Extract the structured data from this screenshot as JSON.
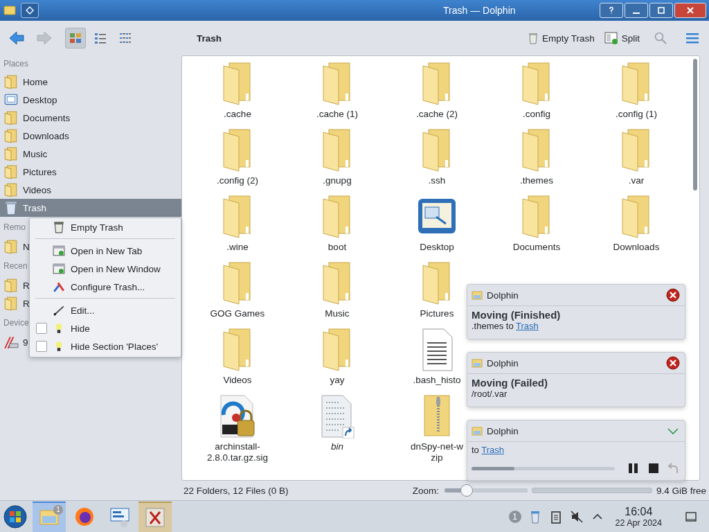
{
  "titlebar": {
    "title": "Trash — Dolphin"
  },
  "toolbar": {
    "view_modes": [
      {
        "selected": true
      },
      {
        "selected": false
      },
      {
        "selected": false
      }
    ],
    "location": "Trash",
    "actions": [
      {
        "label": "Empty Trash"
      },
      {
        "label": "Split"
      }
    ]
  },
  "sidebar": {
    "sections": [
      {
        "title": "Places",
        "items": [
          {
            "label": "Home",
            "selected": false
          },
          {
            "label": "Desktop",
            "selected": false
          },
          {
            "label": "Documents",
            "selected": false
          },
          {
            "label": "Downloads",
            "selected": false
          },
          {
            "label": "Music",
            "selected": false
          },
          {
            "label": "Pictures",
            "selected": false
          },
          {
            "label": "Videos",
            "selected": false
          },
          {
            "label": "Trash",
            "selected": true
          }
        ]
      },
      {
        "title": "Remo",
        "items": [
          {
            "label": "N",
            "selected": false
          }
        ]
      },
      {
        "title": "Recen",
        "items": [
          {
            "label": "R",
            "selected": false
          },
          {
            "label": "R",
            "selected": false
          }
        ]
      },
      {
        "title": "Device",
        "items": [
          {
            "label": "9",
            "selected": false
          }
        ]
      }
    ]
  },
  "context_menu": {
    "items": [
      {
        "kind": "action",
        "label": "Empty Trash"
      },
      {
        "kind": "separator"
      },
      {
        "kind": "action",
        "label": "Open in New Tab"
      },
      {
        "kind": "action",
        "label": "Open in New Window"
      },
      {
        "kind": "action",
        "label": "Configure Trash..."
      },
      {
        "kind": "separator"
      },
      {
        "kind": "action",
        "label": "Edit..."
      },
      {
        "kind": "check",
        "label": "Hide",
        "checked": false
      },
      {
        "kind": "check",
        "label": "Hide Section 'Places'",
        "checked": false
      }
    ]
  },
  "files": {
    "rows": [
      [
        {
          "kind": "folder",
          "name": ".cache"
        },
        {
          "kind": "folder",
          "name": ".cache (1)"
        },
        {
          "kind": "folder",
          "name": ".cache (2)"
        },
        {
          "kind": "folder",
          "name": ".config"
        },
        {
          "kind": "folder",
          "name": ".config (1)"
        }
      ],
      [
        {
          "kind": "folder",
          "name": ".config (2)"
        },
        {
          "kind": "folder",
          "name": ".gnupg"
        },
        {
          "kind": "folder",
          "name": ".ssh"
        },
        {
          "kind": "folder",
          "name": ".themes"
        },
        {
          "kind": "folder",
          "name": ".var"
        }
      ],
      [
        {
          "kind": "folder",
          "name": ".wine"
        },
        {
          "kind": "folder",
          "name": "boot"
        },
        {
          "kind": "desktop",
          "name": "Desktop"
        },
        {
          "kind": "folder",
          "name": "Documents"
        },
        {
          "kind": "folder",
          "name": "Downloads"
        }
      ],
      [
        {
          "kind": "folder",
          "name": "GOG Games"
        },
        {
          "kind": "folder",
          "name": "Music"
        },
        {
          "kind": "folder",
          "name": "Pictures"
        }
      ],
      [
        {
          "kind": "folder",
          "name": "Videos"
        },
        {
          "kind": "folder",
          "name": "yay"
        },
        {
          "kind": "text",
          "name": ".bash_histo"
        }
      ],
      [
        {
          "kind": "signature",
          "name": "archinstall-2.8.0.tar.gz.sig"
        },
        {
          "kind": "binary",
          "name": "bin",
          "link": true
        },
        {
          "kind": "archive",
          "name": "dnSpy-net-w\nzip"
        }
      ]
    ]
  },
  "notifications": [
    {
      "kind": "done",
      "app": "Dolphin",
      "title": "Moving (Finished)",
      "text": ".themes to",
      "link": "Trash"
    },
    {
      "kind": "done",
      "app": "Dolphin",
      "title": "Moving (Failed)",
      "text": "/root/.var"
    },
    {
      "kind": "progress",
      "app": "Dolphin",
      "text": "to",
      "link": "Trash",
      "level": 0.3
    }
  ],
  "status_bar": {
    "summary": "22 Folders, 12 Files (0 B)",
    "zoom_label": "Zoom:",
    "zoom": {
      "level": 0.27
    },
    "free": "9.4 GiB free"
  },
  "taskbar": {
    "tasks": [
      {
        "selected": true,
        "attention": false,
        "badge": "1"
      },
      {
        "selected": false,
        "attention": false
      },
      {
        "selected": false,
        "attention": false
      },
      {
        "selected": false,
        "attention": true
      }
    ],
    "tray": {
      "badge": "1"
    },
    "clock": {
      "time": "16:04",
      "date": "22 Apr 2024"
    }
  }
}
